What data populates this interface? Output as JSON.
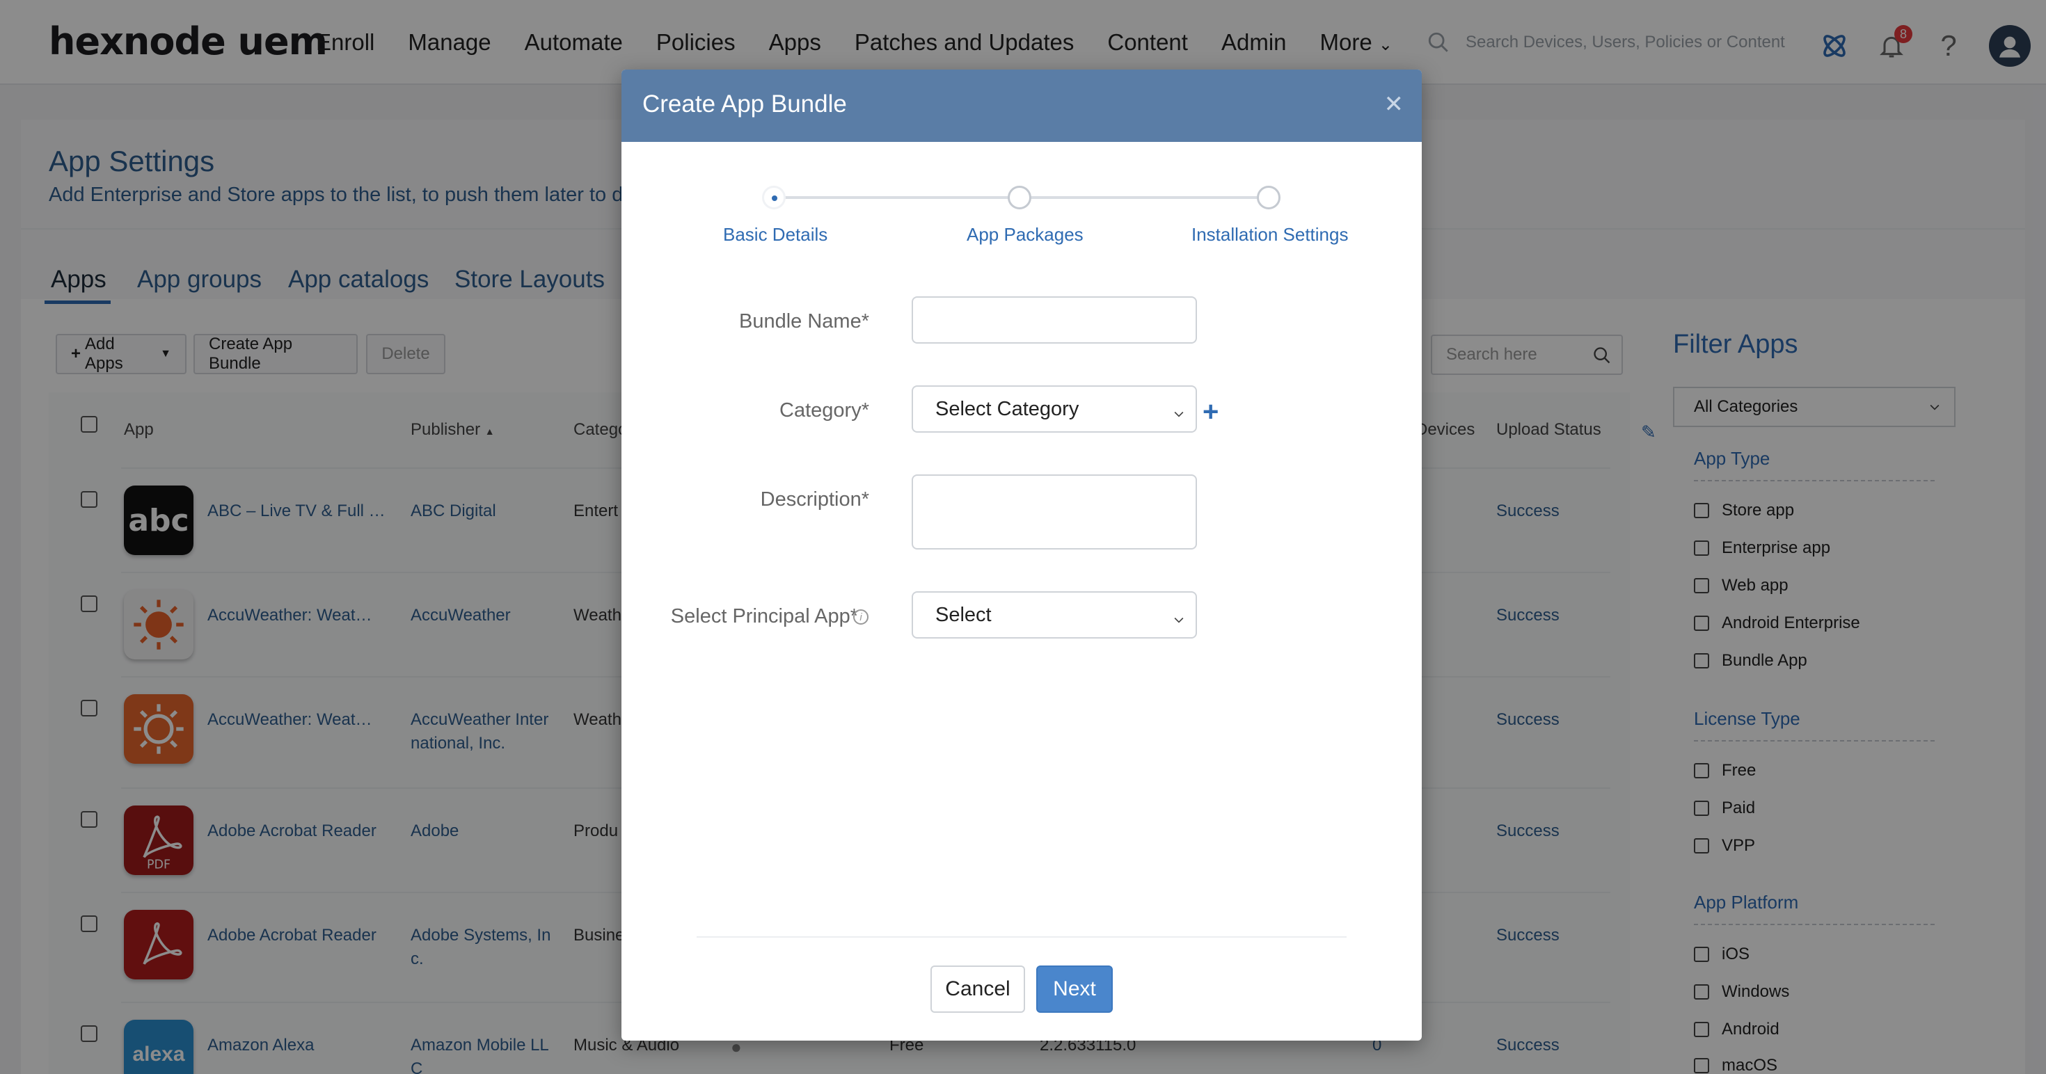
{
  "brand": "hexnode uem",
  "nav": [
    "Enroll",
    "Manage",
    "Automate",
    "Policies",
    "Apps",
    "Patches and Updates",
    "Content",
    "Admin",
    "More"
  ],
  "global_search_placeholder": "Search Devices, Users, Policies or Content",
  "notification_count": "8",
  "page": {
    "title": "App Settings",
    "subtitle": "Add Enterprise and Store apps to the list, to push them later to devic"
  },
  "tabs": [
    "Apps",
    "App groups",
    "App catalogs",
    "Store Layouts"
  ],
  "toolbar": {
    "add_apps": "Add Apps",
    "create_bundle": "Create App Bundle",
    "delete": "Delete",
    "search_placeholder": "Search here"
  },
  "table": {
    "headers": [
      "App",
      "Publisher",
      "Catego",
      "Devices",
      "Upload Status"
    ],
    "rows": [
      {
        "app": "ABC – Live TV & Full …",
        "publisher": "ABC Digital",
        "publisher2": "",
        "category": "Entert",
        "status": "Success"
      },
      {
        "app": "AccuWeather: Weat…",
        "publisher": "AccuWeather",
        "publisher2": "",
        "category": "Weath",
        "status": "Success"
      },
      {
        "app": "AccuWeather: Weat…",
        "publisher": "AccuWeather Inter",
        "publisher2": "national, Inc.",
        "category": "Weath",
        "status": "Success"
      },
      {
        "app": "Adobe Acrobat Reader",
        "publisher": "Adobe",
        "publisher2": "",
        "category": "Produ",
        "status": "Success"
      },
      {
        "app": "Adobe Acrobat Reader",
        "publisher": "Adobe Systems, In",
        "publisher2": "c.",
        "category": "Busine",
        "status": "Success"
      },
      {
        "app": "Amazon Alexa",
        "publisher": "Amazon Mobile LL",
        "publisher2": "C",
        "category": "Music & Audio",
        "license": "Free",
        "version": "2.2.633115.0",
        "devices": "0",
        "status": "Success"
      }
    ]
  },
  "filter": {
    "title": "Filter Apps",
    "category_select": "All Categories",
    "app_type_head": "App Type",
    "app_type": [
      "Store app",
      "Enterprise app",
      "Web app",
      "Android Enterprise",
      "Bundle App"
    ],
    "license_head": "License Type",
    "license": [
      "Free",
      "Paid",
      "VPP"
    ],
    "platform_head": "App Platform",
    "platform": [
      "iOS",
      "Windows",
      "Android",
      "macOS"
    ]
  },
  "modal": {
    "title": "Create App Bundle",
    "steps": [
      "Basic Details",
      "App Packages",
      "Installation Settings"
    ],
    "bundle_name_label": "Bundle Name*",
    "category_label": "Category*",
    "category_value": "Select Category",
    "description_label": "Description*",
    "principal_label": "Select Principal App*",
    "principal_value": "Select",
    "cancel": "Cancel",
    "next": "Next"
  },
  "colors": {
    "accent": "#2f6bb2",
    "modal_header": "#5a7da6",
    "next_button": "#4a86cc"
  }
}
